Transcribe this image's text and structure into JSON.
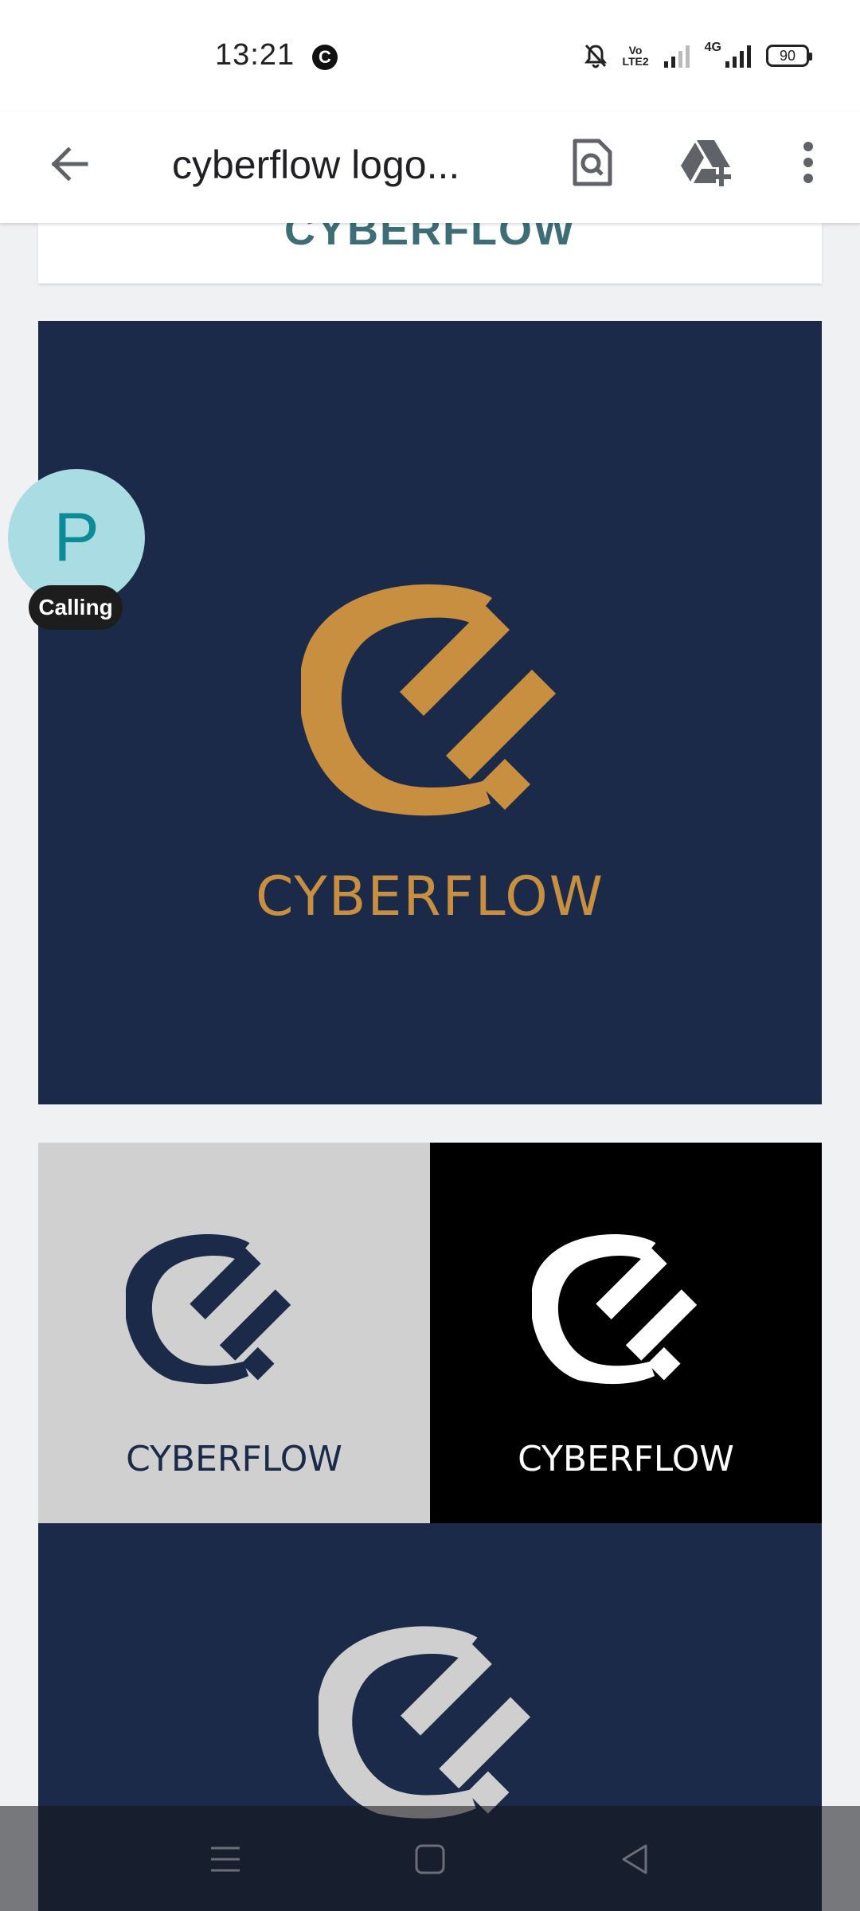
{
  "status_bar": {
    "time": "13:21",
    "carrier_icon_letter": "C",
    "volte_top": "Vo",
    "volte_bottom": "LTE2",
    "network": "4G",
    "battery": "90"
  },
  "app_bar": {
    "title": "cyberflow logo...",
    "icons": [
      "back-arrow-icon",
      "preview-search-icon",
      "add-to-drive-icon",
      "more-vert-icon"
    ]
  },
  "document": {
    "top_strip_text": "CYBERFLOW",
    "main_logo": {
      "wordmark": "CYBERFLOW",
      "color": "#c78f3f",
      "background": "#1b2a48"
    },
    "variants": [
      {
        "wordmark": "CYBERFLOW",
        "color": "#1b2a48",
        "background": "#d0d0d0"
      },
      {
        "wordmark": "CYBERFLOW",
        "color": "#ffffff",
        "background": "#000000"
      },
      {
        "wordmark": "",
        "color": "#cfcfcf",
        "background": "#1b2a48"
      }
    ]
  },
  "call_bubble": {
    "initial": "P",
    "label": "Calling"
  },
  "nav_bar": {
    "buttons": [
      "menu-icon",
      "home-icon",
      "back-triangle-icon"
    ]
  }
}
